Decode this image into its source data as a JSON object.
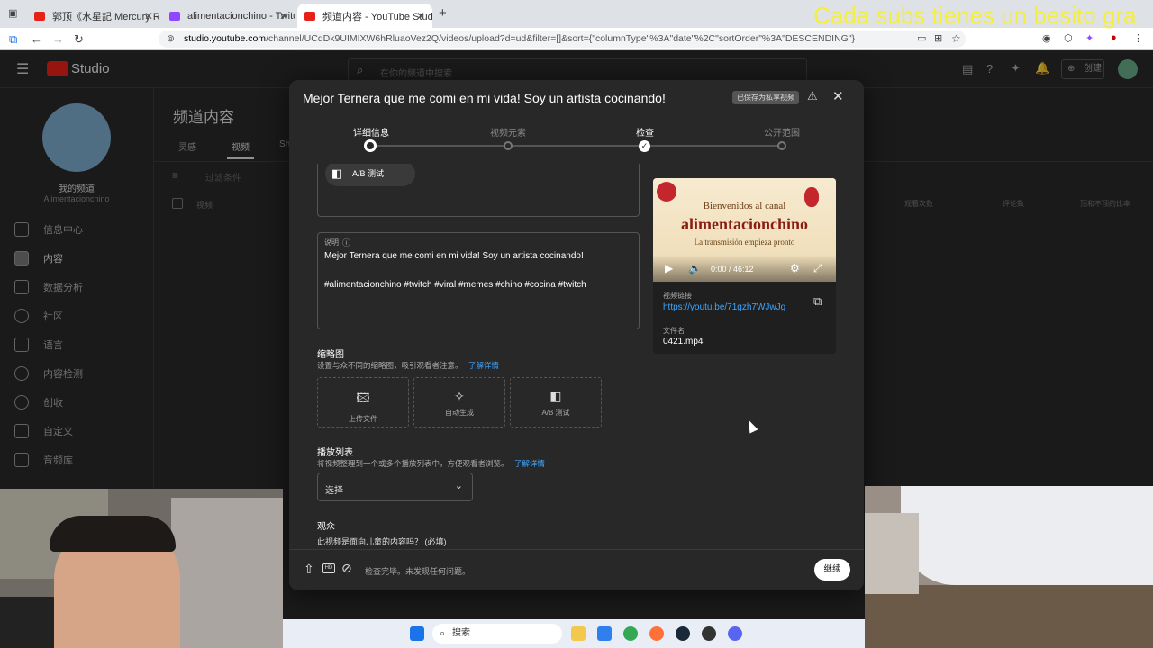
{
  "browser": {
    "tabs": [
      {
        "label": "郭顶《水星記 Mercury Re",
        "active": false,
        "favicon_color": "#e62117"
      },
      {
        "label": "alimentacionchino - Twitch",
        "active": false,
        "favicon_color": "#9146ff"
      },
      {
        "label": "频道内容 - YouTube Studio",
        "active": true,
        "favicon_color": "#e62117"
      }
    ],
    "url_host": "studio.youtube.com",
    "url_path": "/channel/UCdDk9UIMIXW6hRluaoVez2Q/videos/upload?d=ud&filter=[]&sort={\"columnType\"%3A\"date\"%2C\"sortOrder\"%3A\"DESCENDING\"}"
  },
  "stream_overlay_text": "Cada subs tienes un besito gra",
  "studio": {
    "logo": "Studio",
    "search_placeholder": "在你的频道中搜索",
    "create_label": "创建",
    "channel_label": "我的频道",
    "channel_name": "Alimentacionchino",
    "page_title": "频道内容",
    "tabs": [
      "灵感",
      "视频",
      "Sh"
    ],
    "filter_label": "过滤条件",
    "table_headers": [
      "视频",
      "观看次数",
      "评论数",
      "顶和不顶的比率"
    ],
    "nav": [
      "信息中心",
      "内容",
      "数据分析",
      "社区",
      "语言",
      "内容检测",
      "创收",
      "自定义",
      "音频库"
    ],
    "active_nav_index": 1
  },
  "dialog": {
    "title": "Mejor Ternera que me comi en mi vida! Soy un artista cocinando!",
    "saved_badge": "已保存为私享视频",
    "steps": [
      {
        "label": "详细信息",
        "state": "current"
      },
      {
        "label": "视频元素",
        "state": "pending"
      },
      {
        "label": "检查",
        "state": "done"
      },
      {
        "label": "公开范围",
        "state": "pending"
      }
    ],
    "ab_test_label": "A/B 测试",
    "description": {
      "label": "说明",
      "line1": "Mejor Ternera que me comi en mi vida! Soy un artista cocinando!",
      "line2": "#alimentacionchino #twitch #viral #memes #chino #cocina #twitch"
    },
    "thumbnail": {
      "heading": "缩略图",
      "hint": "设置与众不同的缩略图，吸引观看者注意。",
      "learn_more": "了解详情",
      "options": [
        "上传文件",
        "自动生成",
        "A/B 测试"
      ]
    },
    "playlist": {
      "heading": "播放列表",
      "hint": "将视频整理到一个或多个播放列表中，方便观看者浏览。",
      "learn_more": "了解详情",
      "select_value": "选择"
    },
    "audience": {
      "heading": "观众",
      "question": "此视频是面向儿童的内容吗？ (必填)"
    },
    "preview": {
      "banner_line1": "Bienvenidos al canal",
      "banner_line2": "alimentacionchino",
      "banner_line3": "La transmisión empieza pronto",
      "time": "0:00 / 46:12",
      "link_label": "视频链接",
      "link": "https://youtu.be/71gzh7WJwJg",
      "file_label": "文件名",
      "file": "0421.mp4"
    },
    "footer_status": "检查完毕。未发现任何问题。",
    "continue_label": "继续"
  },
  "taskbar": {
    "search_placeholder": "搜索"
  }
}
